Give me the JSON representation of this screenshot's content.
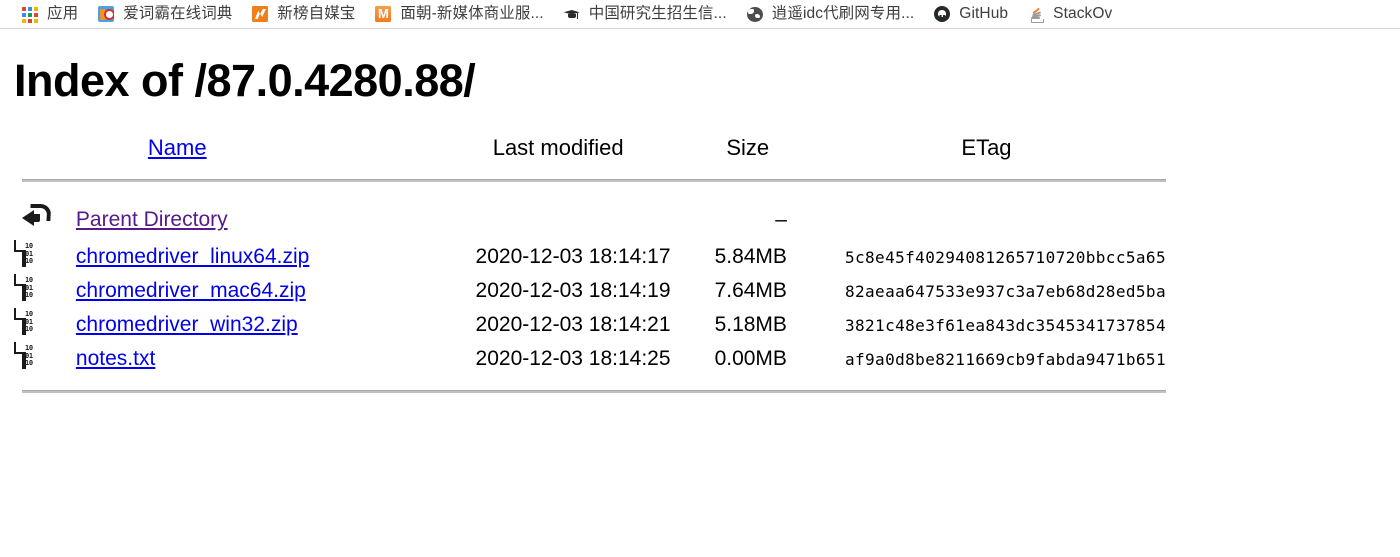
{
  "bookmarks": {
    "items": [
      {
        "label": "应用",
        "icon": "apps-grid-icon"
      },
      {
        "label": "爱词霸在线词典",
        "icon": "dictionary-icon"
      },
      {
        "label": "新榜自媒宝",
        "icon": "newrank-icon"
      },
      {
        "label": "面朝-新媒体商业服...",
        "icon": "mianchao-icon"
      },
      {
        "label": "中国研究生招生信...",
        "icon": "graduation-cap-icon"
      },
      {
        "label": "逍遥idc代刷网专用...",
        "icon": "globe-icon"
      },
      {
        "label": "GitHub",
        "icon": "github-icon"
      },
      {
        "label": "StackOv",
        "icon": "stackoverflow-icon"
      }
    ]
  },
  "page": {
    "title": "Index of /87.0.4280.88/"
  },
  "table": {
    "headers": {
      "name": "Name",
      "last_modified": "Last modified",
      "size": "Size",
      "etag": "ETag"
    },
    "rows": [
      {
        "icon": "back-arrow-icon",
        "name": "Parent Directory",
        "visited": true,
        "last_modified": "",
        "size": "–",
        "etag": ""
      },
      {
        "icon": "binary-file-icon",
        "name": "chromedriver_linux64.zip",
        "visited": false,
        "last_modified": "2020-12-03 18:14:17",
        "size": "5.84MB",
        "etag": "5c8e45f40294081265710720bbcc5a65"
      },
      {
        "icon": "binary-file-icon",
        "name": "chromedriver_mac64.zip",
        "visited": false,
        "last_modified": "2020-12-03 18:14:19",
        "size": "7.64MB",
        "etag": "82aeaa647533e937c3a7eb68d28ed5ba"
      },
      {
        "icon": "binary-file-icon",
        "name": "chromedriver_win32.zip",
        "visited": false,
        "last_modified": "2020-12-03 18:14:21",
        "size": "5.18MB",
        "etag": "3821c48e3f61ea843dc3545341737854"
      },
      {
        "icon": "binary-file-icon",
        "name": "notes.txt",
        "visited": false,
        "last_modified": "2020-12-03 18:14:25",
        "size": "0.00MB",
        "etag": "af9a0d8be8211669cb9fabda9471b651"
      }
    ]
  },
  "colors": {
    "link": "#0000ee",
    "link_visited": "#551a8b",
    "rule": "#c0c0c0",
    "text": "#000000",
    "bookmark_text": "#3c4043",
    "accent_orange": "#f0801a"
  }
}
